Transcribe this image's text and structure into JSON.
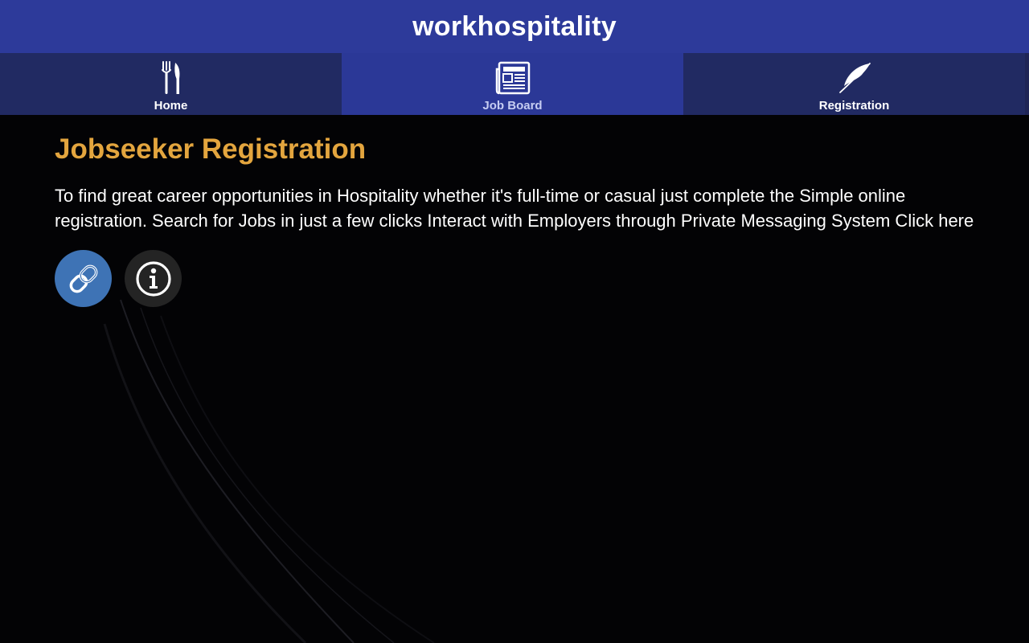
{
  "header": {
    "title": "workhospitality"
  },
  "nav": {
    "tabs": [
      {
        "label": "Home",
        "icon": "fork-knife-icon",
        "active": false
      },
      {
        "label": "Job Board",
        "icon": "newspaper-icon",
        "active": true
      },
      {
        "label": "Registration",
        "icon": "quill-icon",
        "active": false
      }
    ]
  },
  "main": {
    "title": "Jobseeker Registration",
    "description": "To find great career opportunities in Hospitality whether it's full-time or casual just complete the Simple online registration. Search for Jobs in just a few clicks Interact with Employers through Private Messaging System Click here",
    "actions": [
      {
        "icon": "link-icon",
        "color": "#3e73b5"
      },
      {
        "icon": "info-icon",
        "color": "#242424"
      }
    ]
  },
  "colors": {
    "header_bg": "#2d3a9a",
    "nav_bg": "#212a62",
    "nav_active_bg": "#2b3897",
    "title_accent": "#e3a53e",
    "background": "#030305"
  }
}
